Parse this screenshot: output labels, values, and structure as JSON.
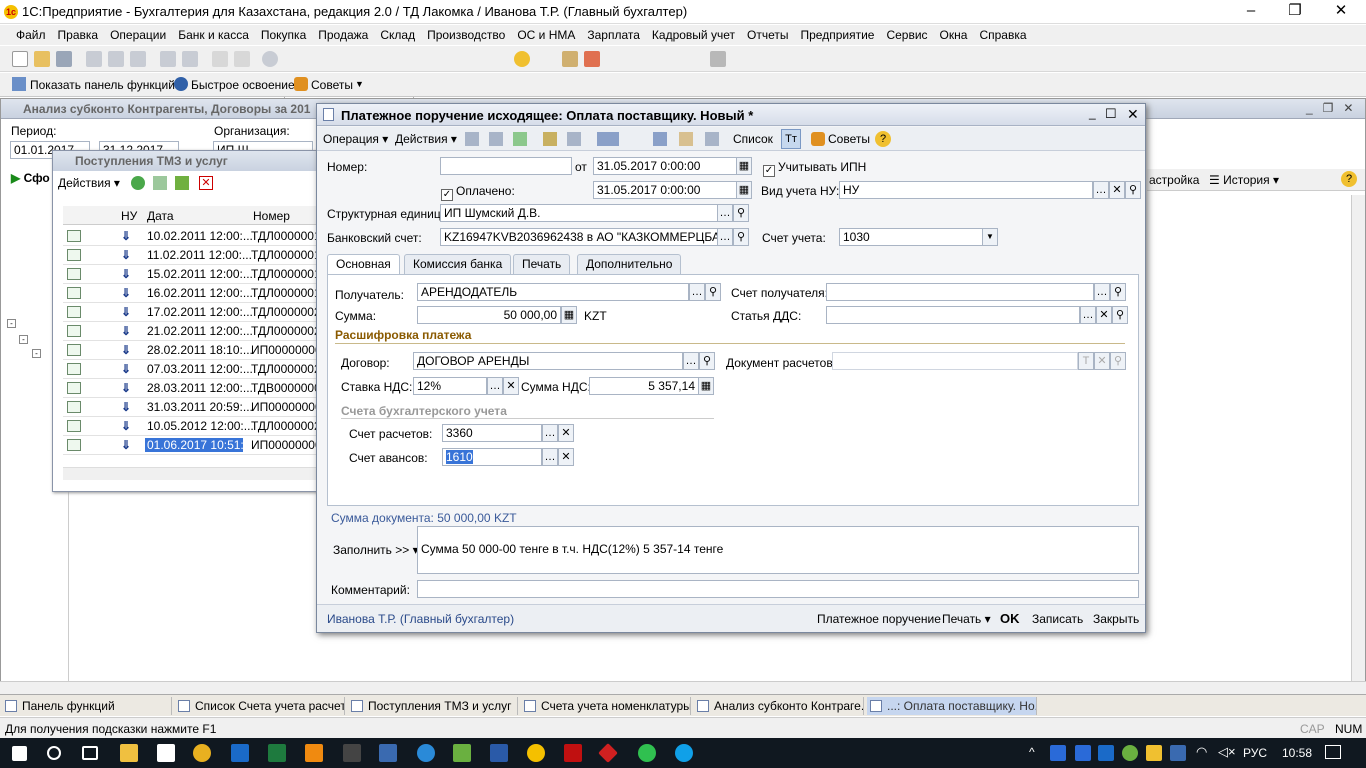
{
  "app": {
    "title": "1С:Предприятие - Бухгалтерия для Казахстана, редакция 2.0 / ТД Лакомка / Иванова Т.Р. (Главный бухгалтер)"
  },
  "menu": [
    "Файл",
    "Правка",
    "Операции",
    "Банк и касса",
    "Покупка",
    "Продажа",
    "Склад",
    "Производство",
    "ОС и НМА",
    "Зарплата",
    "Кадровый учет",
    "Отчеты",
    "Предприятие",
    "Сервис",
    "Окна",
    "Справка"
  ],
  "toolbar2": {
    "functions_panel": "Показать панель функций",
    "quick_learn": "Быстрое освоение",
    "tips": "Советы"
  },
  "bg_window": {
    "title": "Анализ субконто Контрагенты, Договоры за 201",
    "period_label": "Период:",
    "period_from": "01.01.2017",
    "period_to": "31.12.2017",
    "org_label": "Организация:",
    "org_value": "ИП Ш",
    "form_btn": "Сфо",
    "settings_btn": "астройка",
    "history_btn": "История"
  },
  "receipts_window": {
    "title": "Поступления ТМЗ и услуг",
    "actions": "Действия",
    "columns": [
      "НУ",
      "Дата",
      "Номер"
    ],
    "rows": [
      {
        "date": "10.02.2011 12:00:...",
        "num": "ТДЛ0000001"
      },
      {
        "date": "11.02.2011 12:00:...",
        "num": "ТДЛ0000001"
      },
      {
        "date": "15.02.2011 12:00:...",
        "num": "ТДЛ0000001"
      },
      {
        "date": "16.02.2011 12:00:...",
        "num": "ТДЛ0000001"
      },
      {
        "date": "17.02.2011 12:00:...",
        "num": "ТДЛ0000002"
      },
      {
        "date": "21.02.2011 12:00:...",
        "num": "ТДЛ0000002"
      },
      {
        "date": "28.02.2011 18:10:...",
        "num": "ИП00000000"
      },
      {
        "date": "07.03.2011 12:00:...",
        "num": "ТДЛ0000002"
      },
      {
        "date": "28.03.2011 12:00:...",
        "num": "ТДВ0000000"
      },
      {
        "date": "31.03.2011 20:59:...",
        "num": "ИП00000000"
      },
      {
        "date": "10.05.2012 12:00:...",
        "num": "ТДЛ0000002"
      },
      {
        "date": "01.06.2017 10:51:...",
        "num": "ИП00000000"
      }
    ]
  },
  "doc": {
    "title": "Платежное поручение исходящее: Оплата поставщику. Новый *",
    "toolbar": {
      "operation": "Операция",
      "actions": "Действия",
      "list": "Список",
      "tips": "Советы"
    },
    "number_label": "Номер:",
    "number_value": "",
    "from_label": "от",
    "date": "31.05.2017  0:00:00",
    "ipn_label": "Учитывать ИПН",
    "ipn_checked": "✓",
    "paid_label": "Оплачено:",
    "paid_checked": "✓",
    "paid_date": "31.05.2017  0:00:00",
    "nu_type_label": "Вид учета НУ:",
    "nu_type_value": "НУ",
    "unit_label": "Структурная единица:",
    "unit_value": "ИП Шумский Д.В.",
    "bank_label": "Банковский счет:",
    "bank_value": "KZ16947KVB2036962438 в АО \"КАЗКОММЕРЦБАНК\"",
    "account_label": "Счет учета:",
    "account_value": "1030",
    "tabs": [
      "Основная",
      "Комиссия банка",
      "Печать",
      "Дополнительно"
    ],
    "recipient_label": "Получатель:",
    "recipient_value": "АРЕНДОДАТЕЛЬ",
    "recipient_account_label": "Счет получателя:",
    "recipient_account_value": "",
    "sum_label": "Сумма:",
    "sum_value": "50 000,00",
    "currency": "KZT",
    "dds_label": "Статья ДДС:",
    "dds_value": "",
    "decoding_title": "Расшифровка платежа",
    "contract_label": "Договор:",
    "contract_value": "ДОГОВОР АРЕНДЫ",
    "settlement_doc_label": "Документ расчетов:",
    "settlement_doc_value": "",
    "vat_rate_label": "Ставка НДС:",
    "vat_rate_value": "12%",
    "vat_sum_label": "Сумма НДС:",
    "vat_sum_value": "5 357,14",
    "accounting_title": "Счета бухгалтерского учета",
    "settle_acc_label": "Счет расчетов:",
    "settle_acc_value": "3360",
    "advance_acc_label": "Счет авансов:",
    "advance_acc_value": "1610",
    "doc_sum": "Сумма документа: 50 000,00 KZT",
    "fill_label": "Заполнить >>",
    "purpose_value": "Сумма 50 000-00  тенге в т.ч. НДС(12%) 5 357-14 тенге",
    "comment_label": "Комментарий:",
    "comment_value": "",
    "user": "Иванова Т.Р. (Главный бухгалтер)",
    "footer": {
      "payment_order": "Платежное поручение",
      "print": "Печать",
      "ok": "OK",
      "save": "Записать",
      "close": "Закрыть"
    }
  },
  "window_strip": [
    "Панель функций",
    "Список Счета учета расчет...",
    "Поступления ТМЗ и услуг",
    "Счета учета номенклатуры",
    "Анализ субконто Контраге...",
    "...: Оплата поставщику. Но..."
  ],
  "status": {
    "hint": "Для получения подсказки нажмите F1",
    "cap": "CAP",
    "num": "NUM"
  },
  "taskbar": {
    "lang": "РУС",
    "time": "10:58"
  }
}
